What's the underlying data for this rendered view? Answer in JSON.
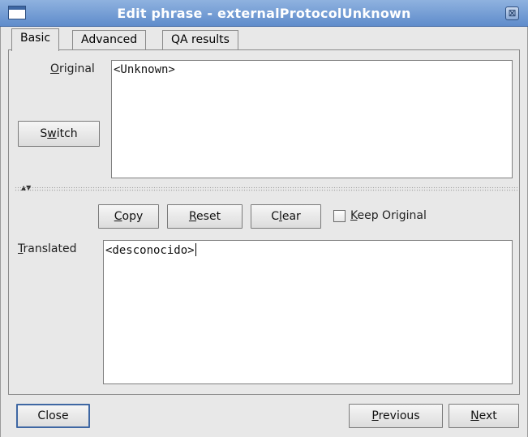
{
  "window": {
    "title": "Edit phrase - externalProtocolUnknown",
    "close_glyph": "⊠"
  },
  "tabs": [
    {
      "label": "Basic",
      "active": true
    },
    {
      "label": "Advanced",
      "active": false
    },
    {
      "label": "QA results",
      "active": false
    }
  ],
  "original": {
    "label_mnemonic": "O",
    "label_rest": "riginal",
    "text": "<Unknown>",
    "switch_pre": "S",
    "switch_mnemonic": "w",
    "switch_post": "itch"
  },
  "splitter": {
    "arrows": "▲▼"
  },
  "actions": {
    "copy_mnemonic": "C",
    "copy_rest": "opy",
    "reset_mnemonic": "R",
    "reset_rest": "eset",
    "clear_pre": "C",
    "clear_mnemonic": "l",
    "clear_post": "ear",
    "keep_mnemonic": "K",
    "keep_rest": "eep Original",
    "keep_checked": false
  },
  "translated": {
    "label_mnemonic": "T",
    "label_rest": "ranslated",
    "text": "<desconocido>"
  },
  "footer": {
    "close_label": "Close",
    "previous_mnemonic": "P",
    "previous_rest": "revious",
    "next_mnemonic": "N",
    "next_rest": "ext"
  }
}
